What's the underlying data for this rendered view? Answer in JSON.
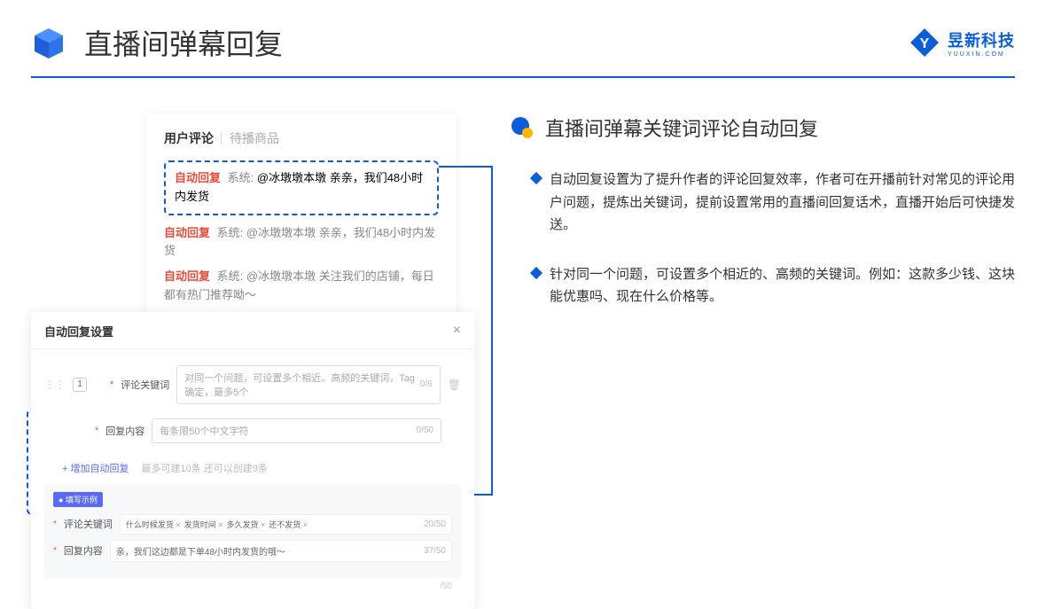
{
  "header": {
    "title": "直播间弹幕回复",
    "logo_name": "昱新科技",
    "logo_sub": "YUUXIN.COM"
  },
  "mock": {
    "tabs": {
      "active": "用户评论",
      "inactive": "待播商品"
    },
    "auto_tag": "自动回复",
    "system_prefix": "系统:",
    "highlighted": "@冰墩墩本墩 亲亲，我们48小时内发货",
    "line2": "@冰墩墩本墩 亲亲，我们48小时内发货",
    "line3": "@冰墩墩本墩 关注我们的店铺，每日都有热门推荐呦～"
  },
  "settings": {
    "title": "自动回复设置",
    "order": "1",
    "keyword_label": "评论关键词",
    "keyword_placeholder": "对同一个问题，可设置多个相近、高频的关键词，Tag确定，最多5个",
    "keyword_count": "0/6",
    "content_label": "回复内容",
    "content_placeholder": "每条限50个中文字符",
    "content_count": "0/50",
    "add_link": "+ 增加自动回复",
    "add_sub": "最多可建10条 还可以创建9条",
    "example_badge": "● 填写示例",
    "ex_keyword_label": "评论关键词",
    "ex_tags": [
      "什么时候发货",
      "发货时间",
      "多久发货",
      "还不发货"
    ],
    "ex_keyword_count": "20/50",
    "ex_content_label": "回复内容",
    "ex_content_value": "亲，我们这边都是下单48小时内发货的哦～",
    "ex_content_count": "37/50",
    "bottom_count": "/50"
  },
  "right": {
    "title": "直播间弹幕关键词评论自动回复",
    "bullet1": "自动回复设置为了提升作者的评论回复效率，作者可在开播前针对常见的评论用户问题，提炼出关键词，提前设置常用的直播间回复话术，直播开始后可快捷发送。",
    "bullet2": "针对同一个问题，可设置多个相近的、高频的关键词。例如：这款多少钱、这块能优惠吗、现在什么价格等。"
  }
}
